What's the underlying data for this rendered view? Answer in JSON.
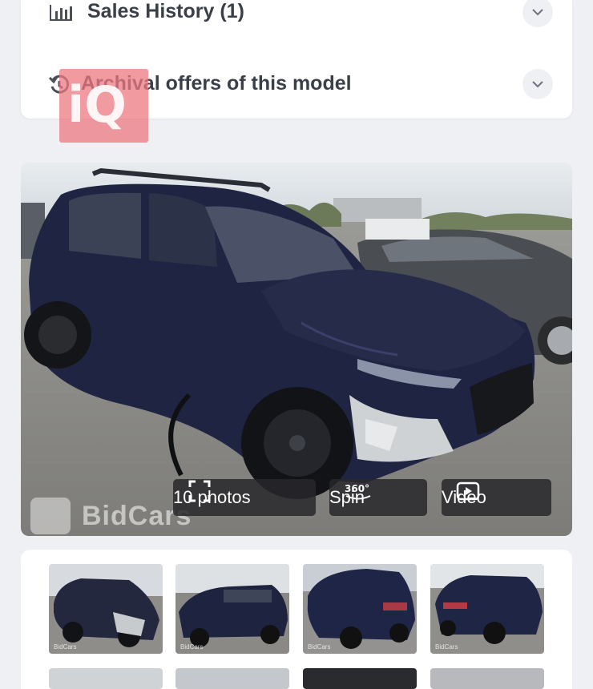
{
  "accordion": {
    "sales_history": {
      "title": "Sales History (1)",
      "icon": "bar-chart-icon"
    },
    "archival": {
      "title": "Archival offers of this model",
      "icon": "history-icon"
    }
  },
  "badge": {
    "text": "iQ"
  },
  "gallery": {
    "watermark": "BidCars",
    "photos_button": {
      "label": "10 photos",
      "icon": "fullscreen-icon"
    },
    "spin_button": {
      "label": "Spin",
      "badge": "360°",
      "icon": "360-icon"
    },
    "video_button": {
      "label": "Video",
      "icon": "play-icon"
    },
    "thumbnail_watermark": "BidCars",
    "thumbnails": [
      "thumb-1",
      "thumb-2",
      "thumb-3",
      "thumb-4"
    ]
  },
  "colors": {
    "accent_badge": "#ec7880",
    "page_bg": "#eef0f4",
    "pill_bg": "#28282c"
  }
}
